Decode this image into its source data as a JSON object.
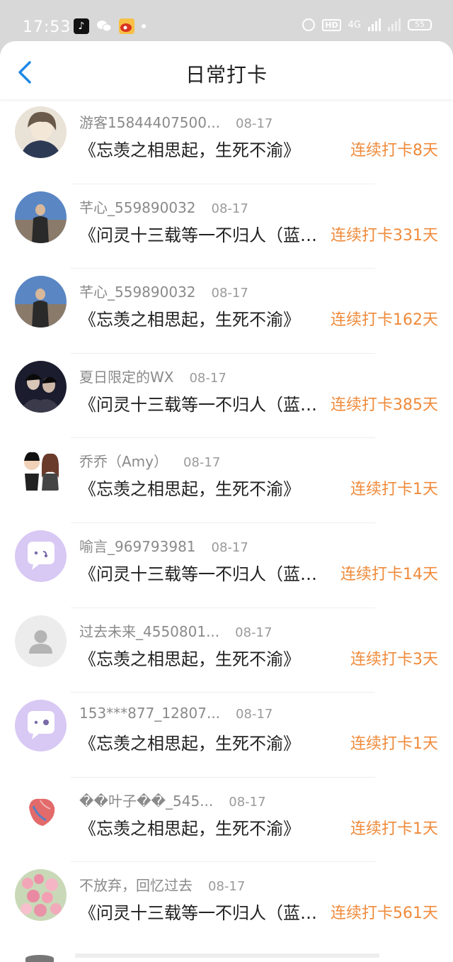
{
  "status_bar": {
    "time": "17:53",
    "apps": [
      "tiktok-icon",
      "wechat-icon",
      "weibo-icon"
    ],
    "hd": "HD",
    "network": "4G",
    "battery": "55"
  },
  "header": {
    "title": "日常打卡",
    "back_icon": "chevron-left-icon"
  },
  "colors": {
    "accent_blue": "#1e88e5",
    "streak_orange": "#ef8a3a",
    "status_bar_bg": "#d8d8d8",
    "muted_text": "#8a8a8a"
  },
  "entries": [
    {
      "name": "游客15844407500...",
      "date": "08-17",
      "book": "《忘羡之相思起，生死不渝》",
      "streak": "连续打卡8天",
      "avatar": "illustrated-woman"
    },
    {
      "name": "芊心_559890032",
      "date": "08-17",
      "book": "《问灵十三载等一不归人（蓝湛...",
      "streak": "连续打卡331天",
      "avatar": "photo-person-sky"
    },
    {
      "name": "芊心_559890032",
      "date": "08-17",
      "book": "《忘羡之相思起，生死不渝》",
      "streak": "连续打卡162天",
      "avatar": "photo-person-sky"
    },
    {
      "name": "夏日限定的WX",
      "date": "08-17",
      "book": "《问灵十三载等一不归人（蓝湛...",
      "streak": "连续打卡385天",
      "avatar": "photo-couple-dark"
    },
    {
      "name": "乔乔（Amy）",
      "date": "08-17",
      "book": "《忘羡之相思起，生死不渝》",
      "streak": "连续打卡1天",
      "avatar": "cartoon-couple"
    },
    {
      "name": "喻言_969793981",
      "date": "08-17",
      "book": "《问灵十三载等一不归人（蓝湛...",
      "streak": "连续打卡14天",
      "avatar": "purple-chat-bubble"
    },
    {
      "name": "过去未来_4550801...",
      "date": "08-17",
      "book": "《忘羡之相思起，生死不渝》",
      "streak": "连续打卡3天",
      "avatar": "default-person"
    },
    {
      "name": "153***877_12807...",
      "date": "08-17",
      "book": "《忘羡之相思起，生死不渝》",
      "streak": "连续打卡1天",
      "avatar": "purple-chat-bubble"
    },
    {
      "name": "��叶子��_545...",
      "date": "08-17",
      "book": "《忘羡之相思起，生死不渝》",
      "streak": "连续打卡1天",
      "avatar": "anatomical-heart"
    },
    {
      "name": "不放弃，回忆过去",
      "date": "08-17",
      "book": "《问灵十三载等一不归人（蓝湛...",
      "streak": "连续打卡561天",
      "avatar": "pink-flowers"
    }
  ]
}
